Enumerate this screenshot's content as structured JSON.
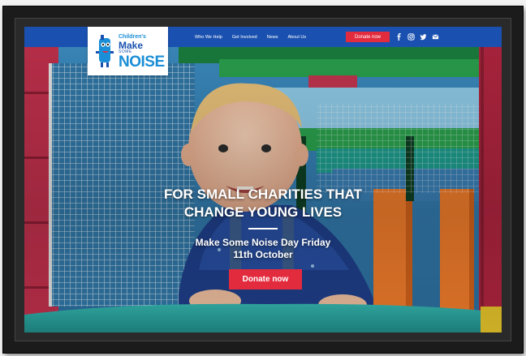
{
  "logo": {
    "line1": "Children's",
    "line2": "Make",
    "line3": "SOME",
    "line4": "NOISE"
  },
  "nav": {
    "links": [
      "Who We Help",
      "Get Involved",
      "News",
      "About Us"
    ],
    "donate_label": "Donate now",
    "socials": [
      "facebook-icon",
      "instagram-icon",
      "twitter-icon",
      "email-icon"
    ]
  },
  "hero": {
    "headline_line1": "FOR SMALL CHARITIES THAT",
    "headline_line2": "CHANGE YOUNG LIVES",
    "subhead_line1": "Make Some Noise Day Friday",
    "subhead_line2": "11th October",
    "donate_label": "Donate now"
  },
  "colors": {
    "brand_blue": "#1a51b0",
    "accent_red": "#e32b3e",
    "logo_light_blue": "#1a8ed6"
  }
}
